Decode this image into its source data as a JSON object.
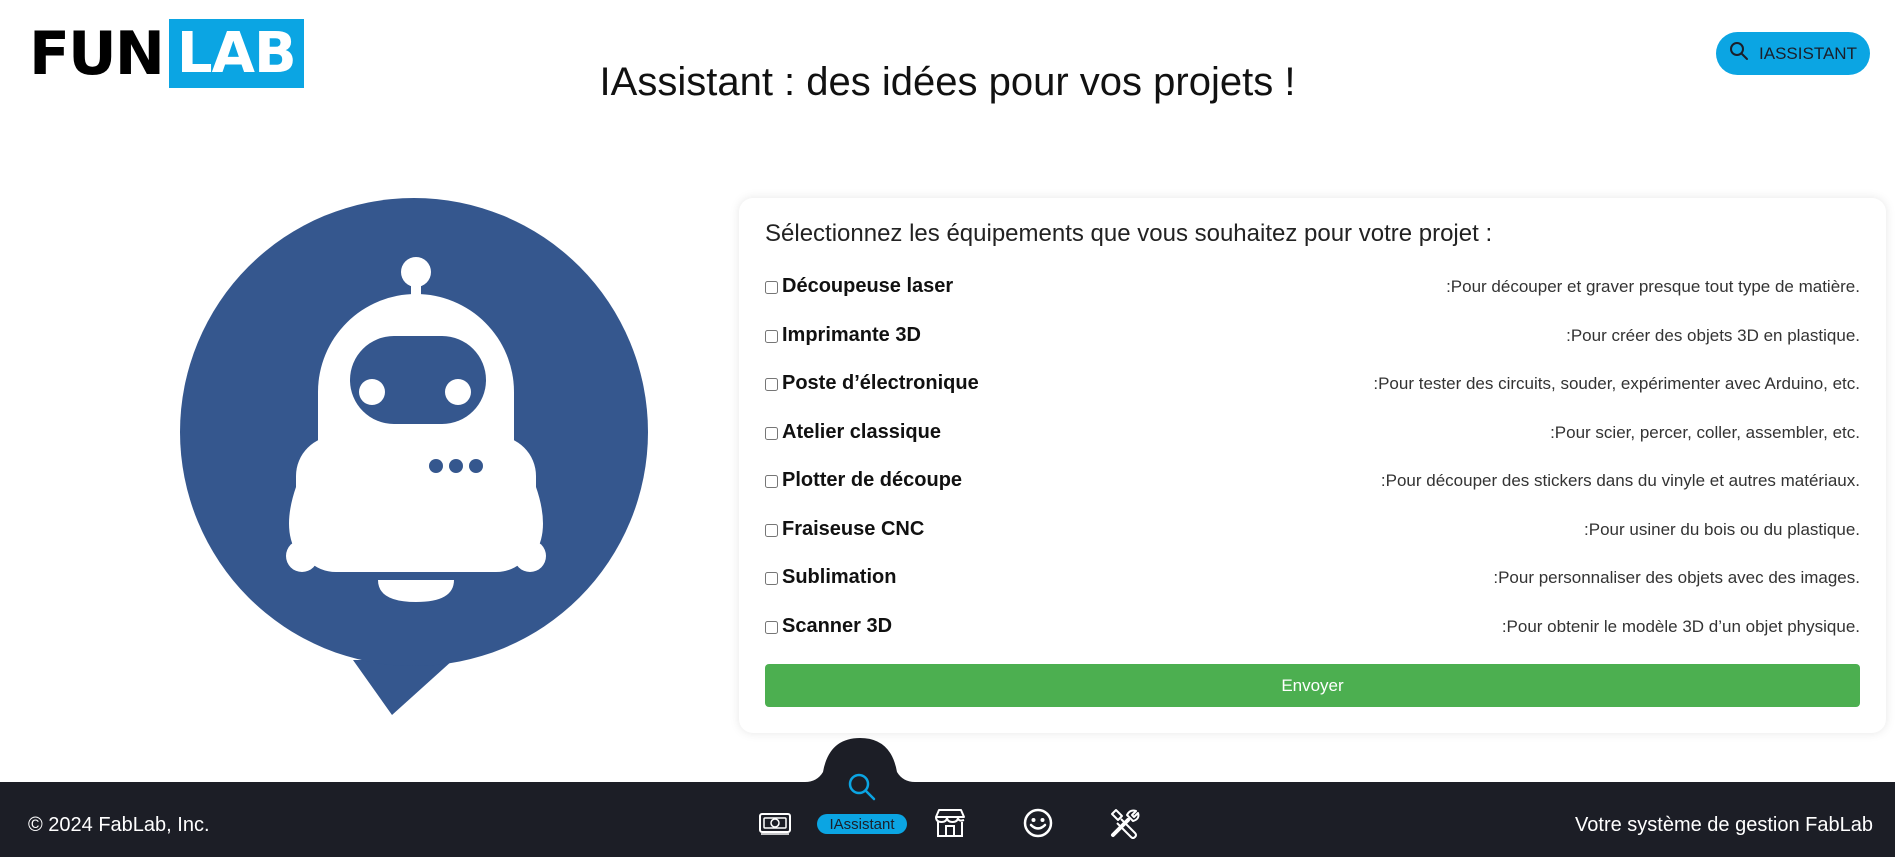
{
  "header": {
    "logo_left": "FUN",
    "logo_right": "LAB",
    "title": "IAssistant : des idées pour vos projets !",
    "top_button_label": "IASSISTANT",
    "top_button_icon": "search-icon"
  },
  "form": {
    "title": "Sélectionnez les équipements que vous souhaitez pour votre projet :",
    "items": [
      {
        "name": "Découpeuse laser",
        "desc": ":Pour découper et graver presque tout type de matière.",
        "checked": false
      },
      {
        "name": "Imprimante 3D",
        "desc": ":Pour créer des objets 3D en plastique.",
        "checked": false
      },
      {
        "name": "Poste d’électronique",
        "desc": ":Pour tester des circuits, souder, expérimenter avec Arduino, etc.",
        "checked": false
      },
      {
        "name": "Atelier classique",
        "desc": ":Pour scier, percer, coller, assembler, etc.",
        "checked": false
      },
      {
        "name": "Plotter de découpe",
        "desc": ":Pour découper des stickers dans du vinyle et autres matériaux.",
        "checked": false
      },
      {
        "name": "Fraiseuse CNC",
        "desc": ":Pour usiner du bois ou du plastique.",
        "checked": false
      },
      {
        "name": "Sublimation",
        "desc": ":Pour personnaliser des objets avec des images.",
        "checked": false
      },
      {
        "name": "Scanner 3D",
        "desc": ":Pour obtenir le modèle 3D d’un objet physique.",
        "checked": false
      }
    ],
    "submit_label": "Envoyer"
  },
  "footer": {
    "copyright": "© 2024 FabLab, Inc.",
    "tagline": "Votre système de gestion FabLab",
    "nav": [
      {
        "icon": "money-icon",
        "label": ""
      },
      {
        "icon": "search-icon",
        "label": "IAssistant",
        "active": true
      },
      {
        "icon": "store-icon",
        "label": ""
      },
      {
        "icon": "smiley-icon",
        "label": ""
      },
      {
        "icon": "tools-icon",
        "label": ""
      }
    ]
  },
  "colors": {
    "accent": "#0ba5e3",
    "robot_bubble": "#35578e",
    "submit": "#4caf50",
    "footer_bg": "#1c1e26"
  }
}
